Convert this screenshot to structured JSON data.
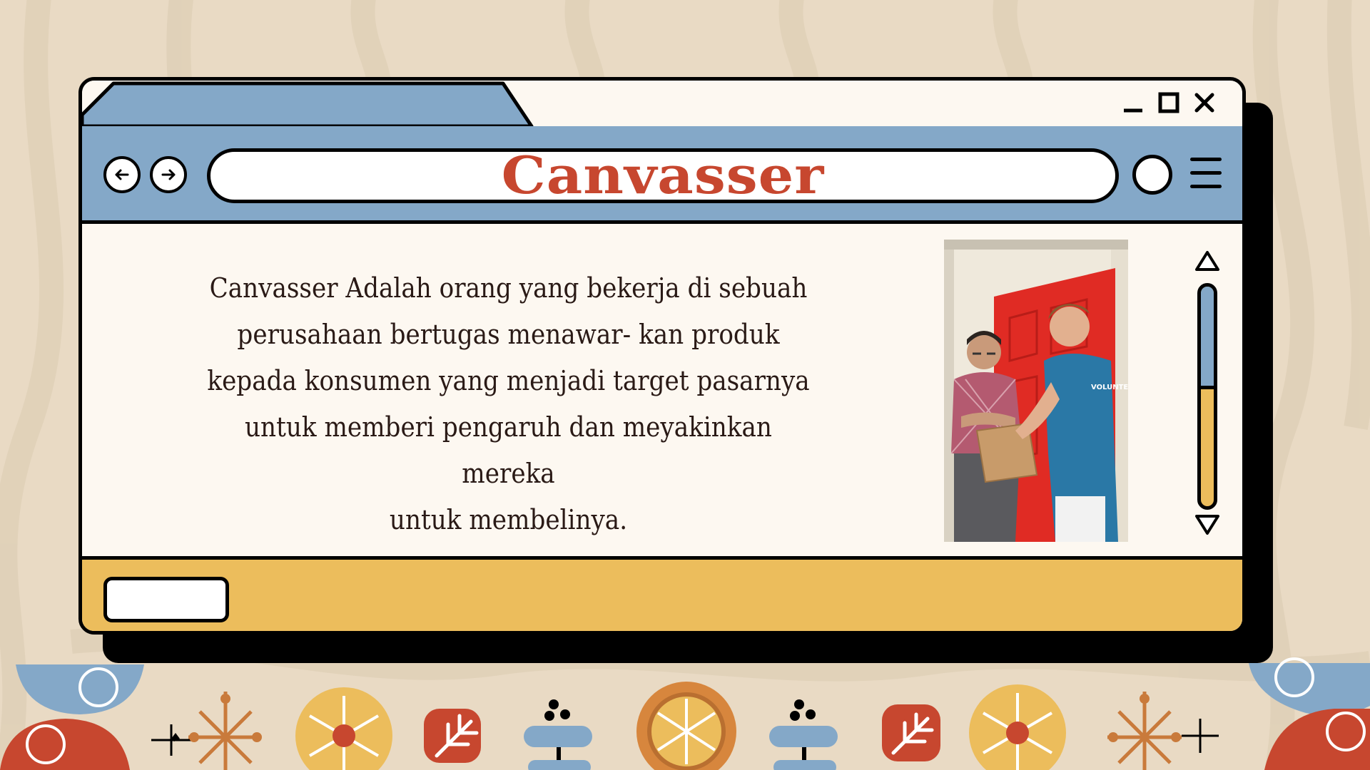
{
  "window": {
    "title": "Canvasser",
    "controls": {
      "minimize": "minimize-icon",
      "maximize": "maximize-icon",
      "close": "close-icon"
    }
  },
  "navigation": {
    "back": "arrow-left-icon",
    "forward": "arrow-right-icon",
    "menu": "hamburger-menu-icon"
  },
  "content": {
    "paragraph_lines": [
      "Canvasser Adalah orang yang bekerja di sebuah",
      "perusahaan bertugas menawar- kan produk",
      "kepada konsumen yang menjadi target pasarnya",
      "untuk memberi pengaruh dan meyakinkan mereka",
      "untuk membelinya."
    ],
    "photo_shirt_text": "VOLUNTEER"
  },
  "scrollbar": {
    "position": 0.45
  },
  "colors": {
    "background": "#e9dac4",
    "address_bar": "#84a8c8",
    "status_bar": "#ecbd5c",
    "title_red": "#c7472f",
    "page": "#fdf8f1"
  }
}
